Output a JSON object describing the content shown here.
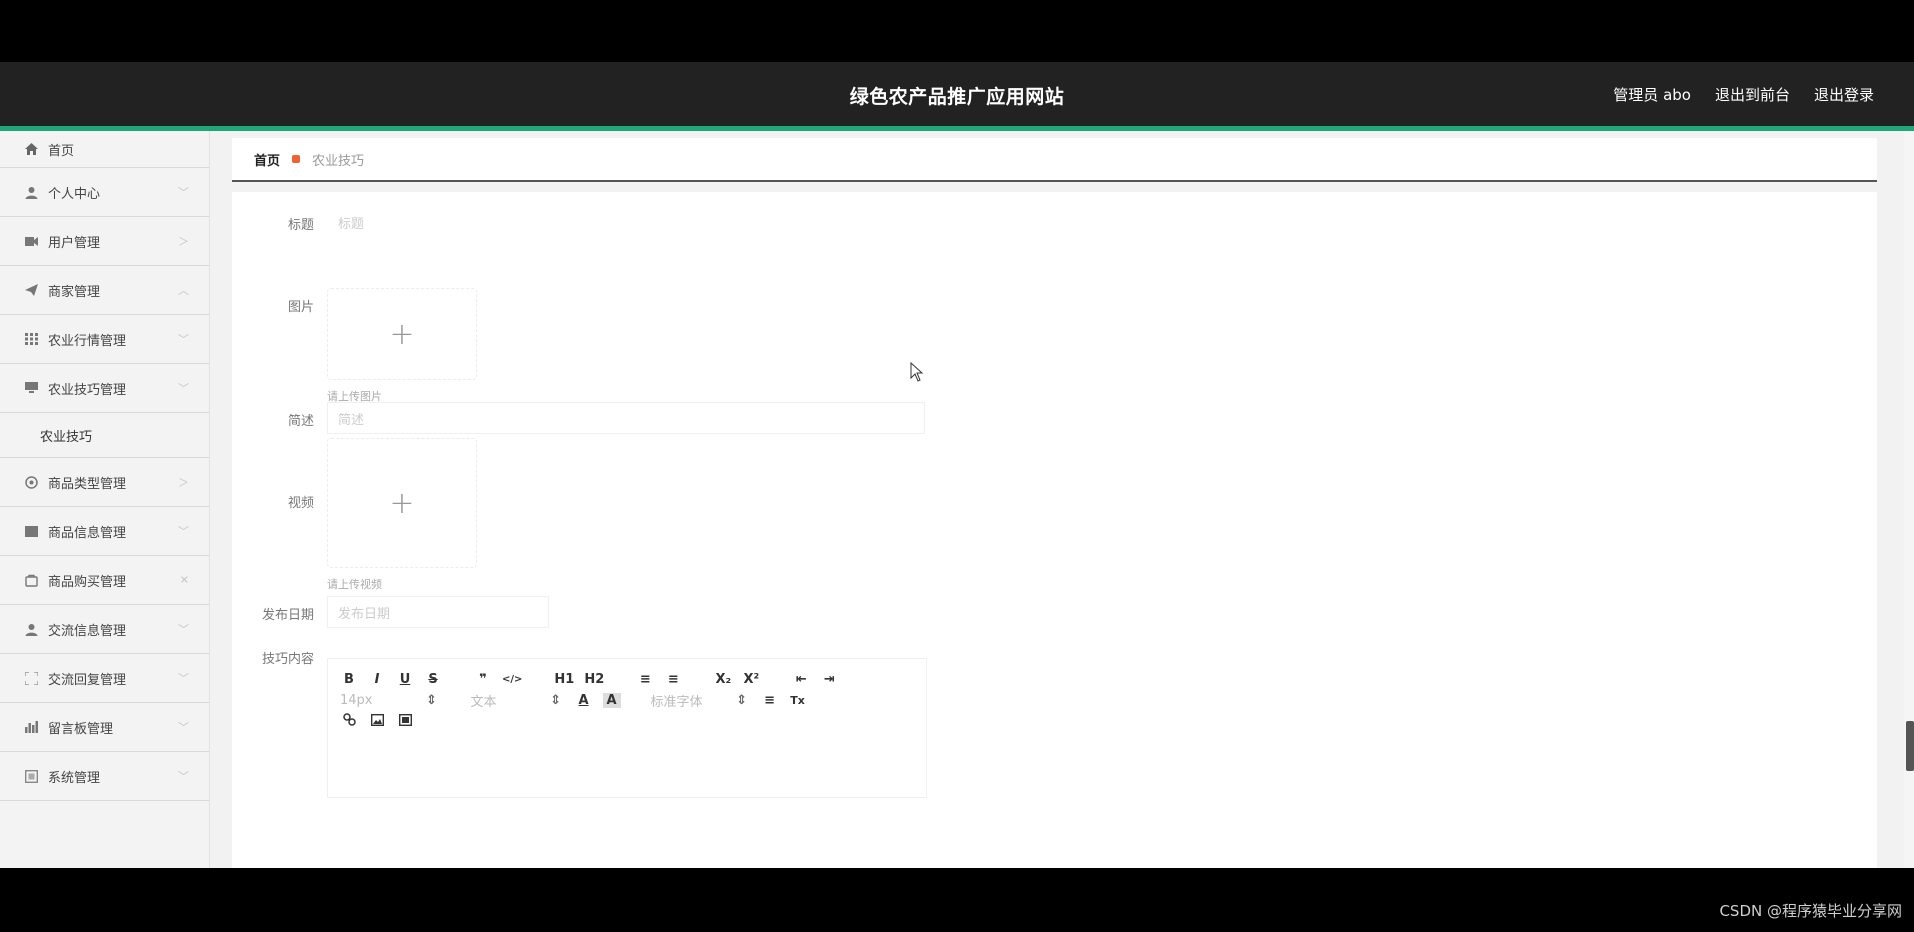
{
  "header": {
    "title": "绿色农产品推广应用网站",
    "user": "管理员 abo",
    "to_front": "退出到前台",
    "logout": "退出登录"
  },
  "sidebar": {
    "items": [
      {
        "label": "首页",
        "icon": "home-icon"
      },
      {
        "label": "个人中心",
        "icon": "user-icon"
      },
      {
        "label": "用户管理",
        "icon": "video-icon"
      },
      {
        "label": "商家管理",
        "icon": "send-icon"
      },
      {
        "label": "农业行情管理",
        "icon": "grid-icon"
      },
      {
        "label": "农业技巧管理",
        "icon": "monitor-icon"
      },
      {
        "label": "商品类型管理",
        "icon": "settings-icon"
      },
      {
        "label": "商品信息管理",
        "icon": "list-icon"
      },
      {
        "label": "商品购买管理",
        "icon": "cart-icon"
      },
      {
        "label": "交流信息管理",
        "icon": "user-icon"
      },
      {
        "label": "交流回复管理",
        "icon": "scan-icon"
      },
      {
        "label": "留言板管理",
        "icon": "chart-icon"
      },
      {
        "label": "系统管理",
        "icon": "system-icon"
      }
    ],
    "sub_item": "农业技巧"
  },
  "breadcrumb": {
    "home": "首页",
    "current": "农业技巧"
  },
  "form": {
    "title_label": "标题",
    "title_placeholder": "标题",
    "image_label": "图片",
    "image_hint": "请上传图片",
    "summary_label": "简述",
    "summary_placeholder": "简述",
    "video_label": "视频",
    "video_hint": "请上传视频",
    "date_label": "发布日期",
    "date_placeholder": "发布日期",
    "content_label": "技巧内容"
  },
  "editor": {
    "bold": "B",
    "italic": "I",
    "underline": "U",
    "strike": "S",
    "quote": "❞",
    "code": "</>",
    "h1": "H1",
    "h2": "H2",
    "ol": "≡",
    "ul": "≡",
    "sub": "X₂",
    "sup": "X²",
    "indent_left": "⇤",
    "indent_right": "⇥",
    "font_size": "14px",
    "text_type": "文本",
    "font_family": "标准字体",
    "color": "A",
    "bg_color": "A",
    "align": "≡",
    "clear": "Tx"
  },
  "watermark": "CSDN @程序猿毕业分享网"
}
